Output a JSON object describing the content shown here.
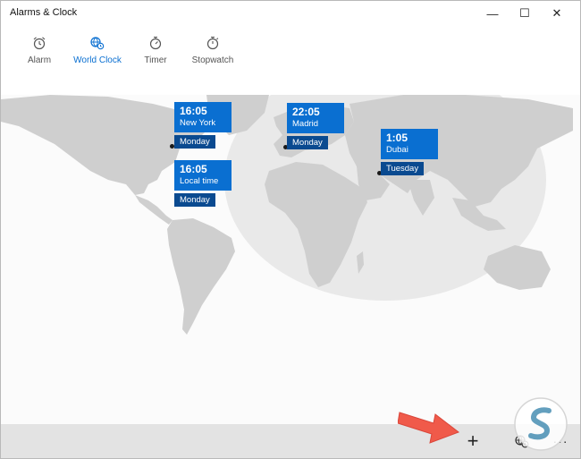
{
  "window": {
    "title": "Alarms & Clock"
  },
  "window_controls": {
    "minimize": "—",
    "maximize": "☐",
    "close": "✕"
  },
  "tabs": [
    {
      "label": "Alarm",
      "icon": "alarm-icon",
      "active": false
    },
    {
      "label": "World Clock",
      "icon": "world-clock-icon",
      "active": true
    },
    {
      "label": "Timer",
      "icon": "timer-icon",
      "active": false
    },
    {
      "label": "Stopwatch",
      "icon": "stopwatch-icon",
      "active": false
    }
  ],
  "clocks": [
    {
      "time": "16:05",
      "city": "New York",
      "day": "Monday"
    },
    {
      "time": "16:05",
      "city": "Local time",
      "day": "Monday"
    },
    {
      "time": "22:05",
      "city": "Madrid",
      "day": "Monday"
    },
    {
      "time": "1:05",
      "city": "Dubai",
      "day": "Tuesday"
    }
  ],
  "commands": {
    "add": "+",
    "compare": "compare-clocks-icon",
    "more": "···"
  },
  "colors": {
    "accent": "#0a6fd1",
    "day_badge": "#0a4a90",
    "land": "#cfcfcf",
    "night_shade": "#e8e8e8",
    "command_bar": "#e3e3e3",
    "annotation_arrow": "#f05a4a"
  }
}
